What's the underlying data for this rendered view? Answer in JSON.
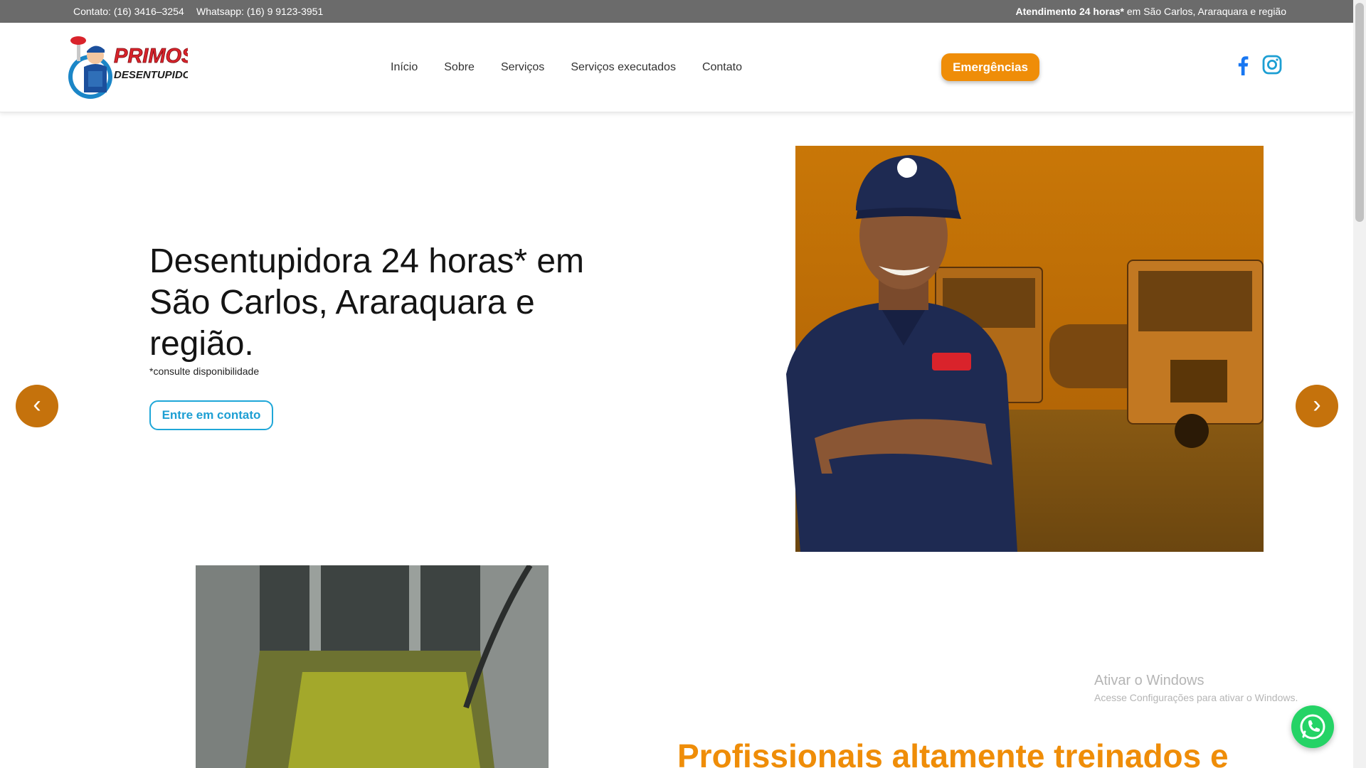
{
  "topbar": {
    "contact": "Contato: (16) 3416–3254",
    "whatsapp": "Whatsapp: (16) 9 9123-3951",
    "service_bold": "Atendimento 24 horas*",
    "service_rest": " em São Carlos, Araraquara e região"
  },
  "logo": {
    "line1": "PRIMOS",
    "line2": "DESENTUPIDORA"
  },
  "nav": {
    "items": [
      {
        "label": "Início"
      },
      {
        "label": "Sobre"
      },
      {
        "label": "Serviços"
      },
      {
        "label": "Serviços executados"
      },
      {
        "label": "Contato"
      }
    ]
  },
  "header": {
    "emergency_label": "Emergências",
    "social_icons": [
      "facebook-icon",
      "instagram-icon"
    ]
  },
  "hero": {
    "title": "Desentupidora 24 horas* em São Carlos, Araraquara e região.",
    "note": "*consulte disponibilidade",
    "cta_label": "Entre em contato",
    "arrow_prev": "‹",
    "arrow_next": "›"
  },
  "section": {
    "title": "Profissionais altamente treinados e"
  },
  "overlay": {
    "windows_title": "Ativar o Windows",
    "windows_sub": "Acesse Configurações para ativar o Windows."
  },
  "colors": {
    "accent_orange": "#ef8d08",
    "arrow_orange": "#c5720c",
    "link_blue": "#1d9fd3",
    "topbar_gray": "#6b6b6b",
    "whatsapp_green": "#25d366"
  }
}
